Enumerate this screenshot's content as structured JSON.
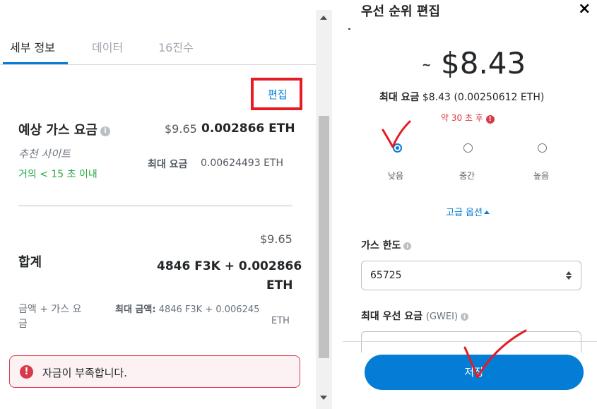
{
  "left": {
    "tabs": [
      {
        "label": "세부 정보",
        "active": true
      },
      {
        "label": "데이터",
        "active": false
      },
      {
        "label": "16진수",
        "active": false
      }
    ],
    "edit_label": "편집",
    "gas": {
      "title": "예상 가스 요금",
      "usd": "$9.65",
      "eth": "0.002866 ETH",
      "recommend": "추천 사이트",
      "likely": "거의 < 15 초 이내",
      "max_fee_label": "최대 요금",
      "max_fee_value": "0.00624493 ETH"
    },
    "total": {
      "usd": "$9.65",
      "title": "합계",
      "amount_line1": "4846 F3K + 0.002866",
      "amount_line2": "ETH",
      "amount_gas_line1": "금액 + 가스 요",
      "amount_gas_line2": "금",
      "max_amount_label": "최대 금액:",
      "max_amount_value": "4846 F3K + 0.006245",
      "max_amount_line2": "ETH"
    },
    "error": {
      "icon": "!",
      "text": "자금이 부족합니다."
    }
  },
  "right": {
    "title": "우선 순위 편집",
    "close_icon": "×",
    "tilde": "~",
    "big_fee": "$8.43",
    "max_fee_label": "최대 요금",
    "max_fee_value": "$8.43 (0.00250612 ETH)",
    "time_estimate": "약 30 초 후",
    "time_icon": "!",
    "options": [
      {
        "label": "낮음",
        "selected": true
      },
      {
        "label": "중간",
        "selected": false
      },
      {
        "label": "높음",
        "selected": false
      }
    ],
    "advanced_label": "고급 옵션",
    "gas_limit_label": "가스 한도",
    "gas_limit_value": "65725",
    "priority_label": "최대 우선 요금",
    "priority_unit": "(GWEI)",
    "save_label": "저장"
  },
  "colors": {
    "accent": "#037dd6",
    "error": "#d73a49",
    "success": "#28a745",
    "annotation_red": "#e51c23"
  }
}
